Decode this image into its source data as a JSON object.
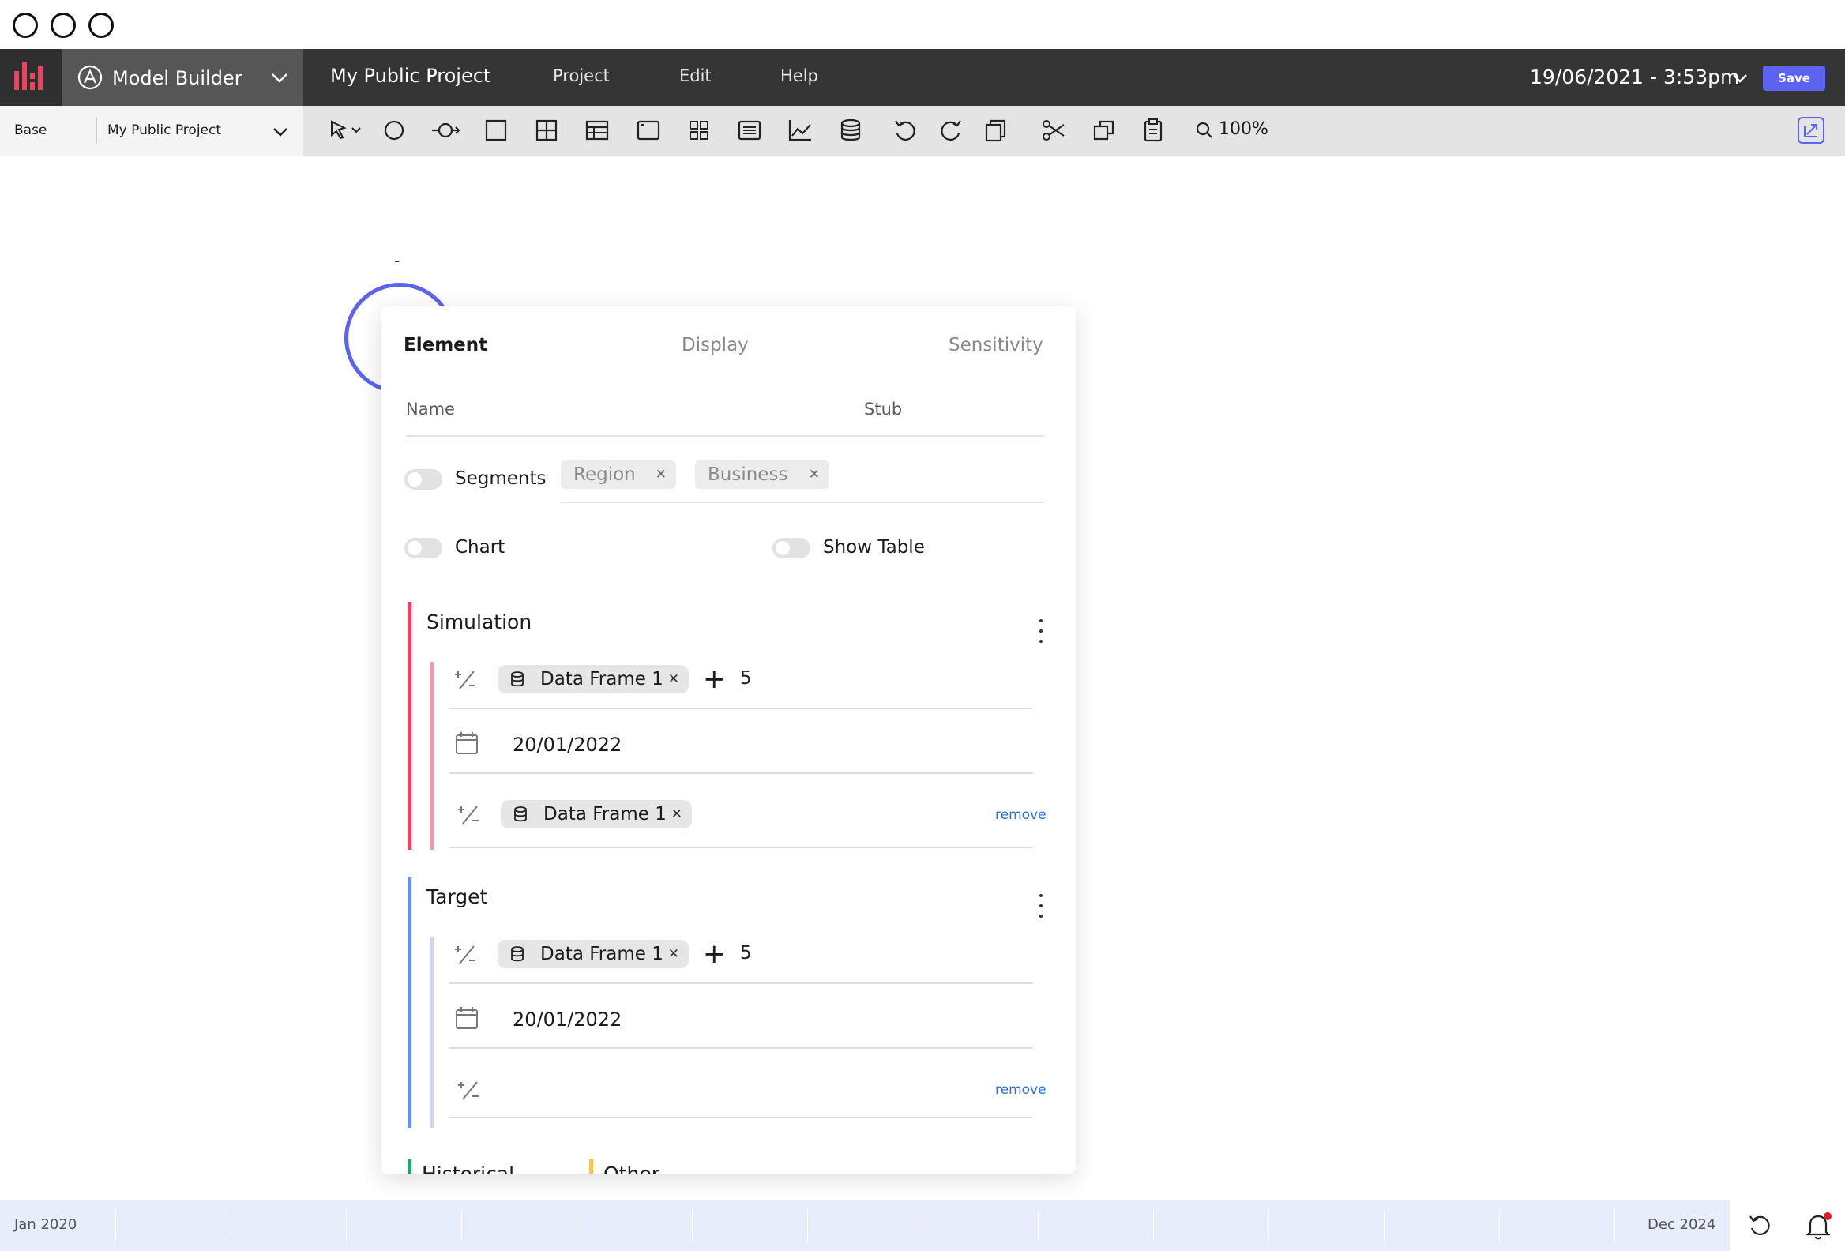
{
  "window": {
    "controls": [
      "close",
      "minimize",
      "maximize"
    ]
  },
  "header": {
    "app_name": "Model Builder",
    "project_title": "My Public Project",
    "menu": [
      {
        "label": "Project"
      },
      {
        "label": "Edit"
      },
      {
        "label": "Help"
      }
    ],
    "datetime": "19/06/2021 - 3:53pm",
    "save_label": "Save",
    "brand_color": "#e8465f",
    "accent_color": "#5b63f0"
  },
  "toolbar": {
    "scenario": "Base",
    "project_select": "My Public Project",
    "zoom": "100%",
    "tools": [
      "select-icon",
      "circle-icon",
      "connector-icon",
      "square-icon",
      "grid-icon",
      "table-icon",
      "frame-icon",
      "tiles-icon",
      "list-icon",
      "line-chart-icon",
      "database-icon",
      "undo-icon",
      "redo-icon",
      "copy-layer-icon",
      "cut-icon",
      "duplicate-icon",
      "clipboard-icon",
      "zoom-icon"
    ]
  },
  "canvas": {
    "node_label": "-"
  },
  "panel": {
    "tabs": [
      {
        "label": "Element",
        "active": true
      },
      {
        "label": "Display",
        "active": false
      },
      {
        "label": "Sensitivity",
        "active": false
      }
    ],
    "name_label": "Name",
    "stub_label": "Stub",
    "segments": {
      "label": "Segments",
      "enabled": false,
      "tags": [
        "Region",
        "Business"
      ]
    },
    "chart_toggle": {
      "label": "Chart",
      "enabled": false
    },
    "table_toggle": {
      "label": "Show Table",
      "enabled": false
    },
    "sections": [
      {
        "title": "Simulation",
        "color": "#e8465f",
        "sub_color": "#f29aa8",
        "rows": [
          {
            "chip": "Data Frame 1",
            "plus": "+",
            "count": "5"
          },
          {
            "date": "20/01/2022"
          },
          {
            "chip": "Data Frame 1",
            "action": "remove"
          }
        ]
      },
      {
        "title": "Target",
        "color": "#6d8ff0",
        "sub_color": "#cad6f8",
        "rows": [
          {
            "chip": "Data Frame 1",
            "plus": "+",
            "count": "5"
          },
          {
            "date": "20/01/2022"
          },
          {
            "action": "remove"
          }
        ]
      }
    ],
    "cut_sections": [
      {
        "title": "Historical",
        "color": "#2e9e6a"
      },
      {
        "title": "Other",
        "color": "#f5c654"
      }
    ]
  },
  "timeline": {
    "start": "Jan 2020",
    "end": "Dec 2024"
  }
}
